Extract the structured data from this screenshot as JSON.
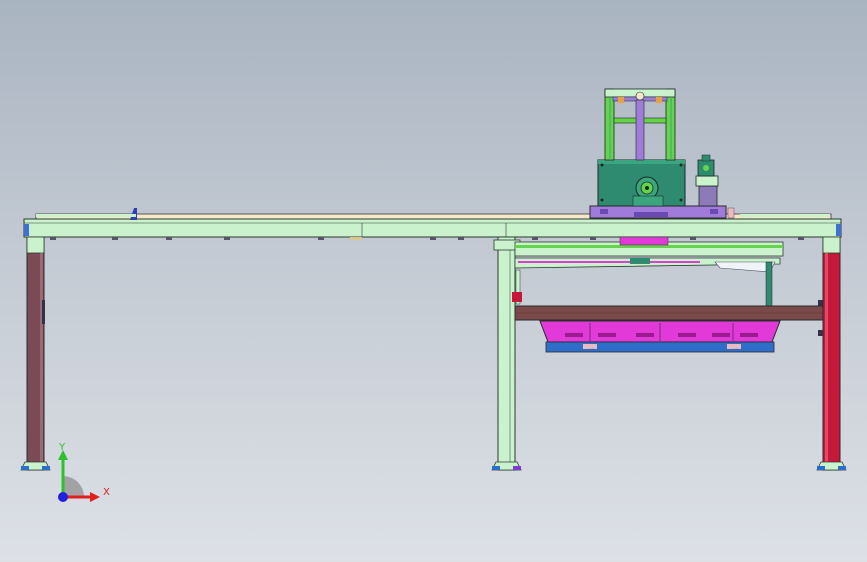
{
  "viewport": {
    "background_top": "#a9b4c1",
    "background_bottom": "#dde1e6"
  },
  "colors": {
    "frame_green": "#c9f2cd",
    "frame_outline": "#2b3b2e",
    "left_leg": "#7a4a55",
    "right_leg": "#c5183a",
    "beam_brown": "#7a4a4a",
    "magenta": "#e23ad8",
    "blue": "#2d6ec9",
    "teal": "#2e8b6f",
    "purple": "#a07bdc",
    "lime": "#66d44a",
    "rail_tan": "#f5e7c8"
  },
  "triad": {
    "x_label": "X",
    "y_label": "Y",
    "x_color": "#e0201c",
    "y_color": "#2fc02f",
    "z_color": "#2020e0"
  }
}
